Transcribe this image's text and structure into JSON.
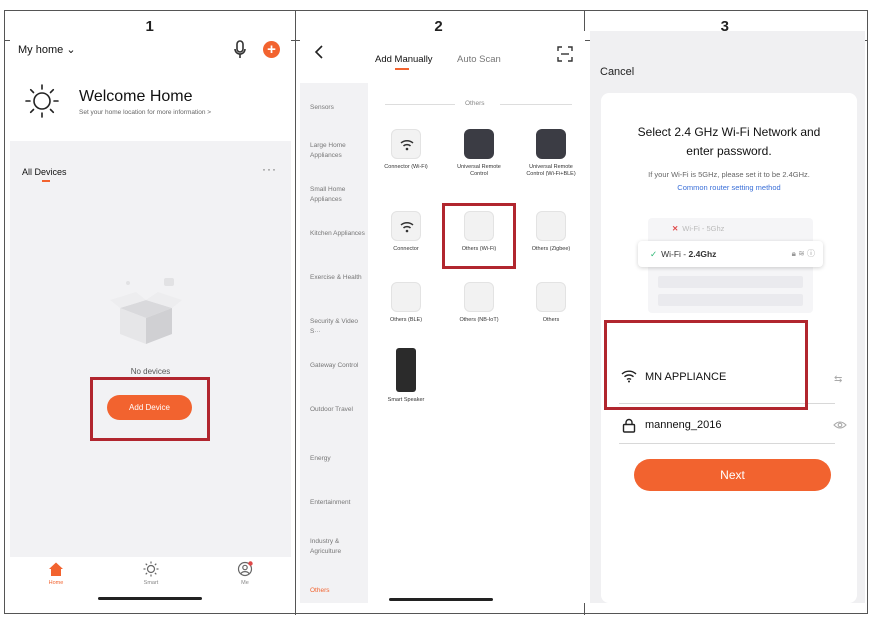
{
  "headers": [
    "1",
    "2",
    "3"
  ],
  "colors": {
    "accent": "#f2632f",
    "highlight": "#b1262e",
    "link": "#3a6fd8"
  },
  "panel1": {
    "home_label": "My home",
    "welcome_title": "Welcome Home",
    "welcome_sub": "Set your home location for more information >",
    "all_devices": "All Devices",
    "more": "···",
    "no_devices": "No devices",
    "add_device": "Add Device",
    "tabs": [
      {
        "label": "Home",
        "icon": "home-icon",
        "active": true
      },
      {
        "label": "Smart",
        "icon": "sun-icon",
        "active": false
      },
      {
        "label": "Me",
        "icon": "profile-icon",
        "active": false
      }
    ]
  },
  "panel2": {
    "tab_manual": "Add Manually",
    "tab_auto": "Auto Scan",
    "category_header": "Others",
    "sidebar": [
      "Sensors",
      "Large Home Appliances",
      "Small Home Appliances",
      "Kitchen Appliances",
      "Exercise & Health",
      "Security & Video S···",
      "Gateway Control",
      "Outdoor Travel",
      "Energy",
      "Entertainment",
      "Industry & Agriculture",
      "Others"
    ],
    "devices": [
      {
        "label": "Connector (Wi-Fi)",
        "tile": "wifi"
      },
      {
        "label": "Universal Remote Control",
        "tile": "dark"
      },
      {
        "label": "Universal Remote Control (Wi-Fi+BLE)",
        "tile": "dark"
      },
      {
        "label": "Connector",
        "tile": "wifi"
      },
      {
        "label": "Others (Wi-Fi)",
        "tile": "light"
      },
      {
        "label": "Others (Zigbee)",
        "tile": "light"
      },
      {
        "label": "Others (BLE)",
        "tile": "light"
      },
      {
        "label": "Others (NB-IoT)",
        "tile": "light"
      },
      {
        "label": "Others",
        "tile": "light"
      },
      {
        "label": "Smart Speaker",
        "tile": "speaker"
      }
    ]
  },
  "panel3": {
    "cancel": "Cancel",
    "title": "Select 2.4 GHz Wi-Fi Network and enter password.",
    "note": "If your Wi-Fi is 5GHz, please set it to be 2.4GHz.",
    "link": "Common router setting method",
    "wifi_5g": "Wi-Fi - 5Ghz",
    "wifi_24_prefix": "Wi-Fi - ",
    "wifi_24_bold": "2.4Ghz",
    "ssid": "MN APPLIANCE",
    "password": "manneng_2016",
    "next": "Next"
  }
}
